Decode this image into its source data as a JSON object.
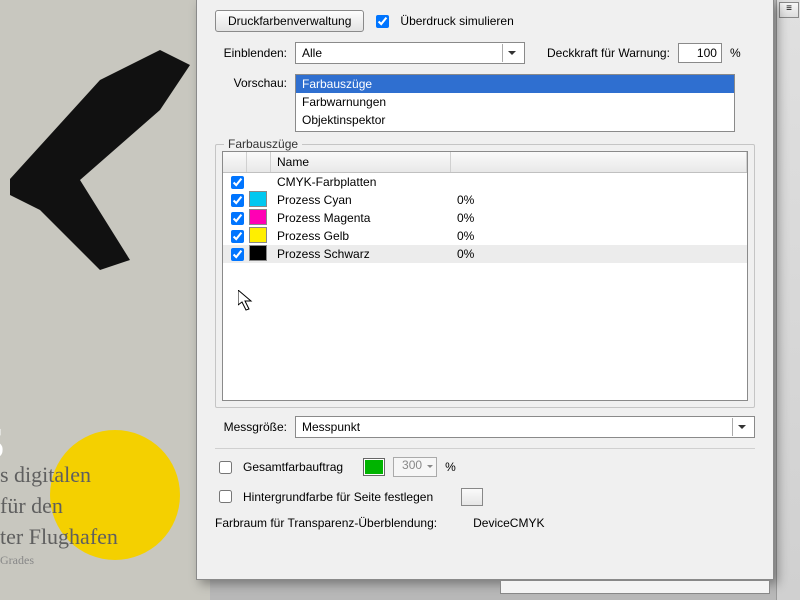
{
  "bg_text": {
    "s": "s",
    "l1": "s digitalen",
    "l2": "für den",
    "l3": "ter Flughafen",
    "l4": "Grades"
  },
  "toolbar": {
    "ink_mgmt_label": "Druckfarbenverwaltung",
    "overprint_label": "Überdruck simulieren",
    "overprint_checked": true
  },
  "show": {
    "label": "Einblenden:",
    "value": "Alle",
    "opacity_label": "Deckkraft für Warnung:",
    "opacity_value": "100",
    "percent": "%"
  },
  "preview": {
    "label": "Vorschau:",
    "items": [
      "Farbauszüge",
      "Farbwarnungen",
      "Objektinspektor"
    ],
    "selected_index": 0
  },
  "separations": {
    "group_title": "Farbauszüge",
    "name_header": "Name",
    "rows": [
      {
        "checked": true,
        "swatch": null,
        "name": "CMYK-Farbplatten",
        "value": ""
      },
      {
        "checked": true,
        "swatch": "#00c8f0",
        "name": "Prozess Cyan",
        "value": "0%"
      },
      {
        "checked": true,
        "swatch": "#ff00b4",
        "name": "Prozess Magenta",
        "value": "0%"
      },
      {
        "checked": true,
        "swatch": "#ffef00",
        "name": "Prozess Gelb",
        "value": "0%"
      },
      {
        "checked": true,
        "swatch": "#000000",
        "name": "Prozess Schwarz",
        "value": "0%",
        "hl": true
      }
    ]
  },
  "sample": {
    "label": "Messgröße:",
    "value": "Messpunkt"
  },
  "tac": {
    "label": "Gesamtfarbauftrag",
    "checked": false,
    "swatch": "#00b400",
    "value": "300",
    "percent": "%"
  },
  "bgcolor": {
    "label": "Hintergrundfarbe für Seite festlegen",
    "checked": false
  },
  "blend": {
    "label": "Farbraum für Transparenz-Überblendung:",
    "value": "DeviceCMYK"
  }
}
